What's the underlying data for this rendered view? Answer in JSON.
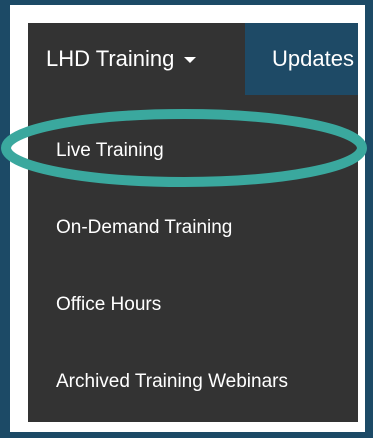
{
  "nav": {
    "menu_label": "LHD Training",
    "next_label": "Updates"
  },
  "dropdown": {
    "items": [
      {
        "label": "Live Training"
      },
      {
        "label": "On-Demand Training"
      },
      {
        "label": "Office Hours"
      },
      {
        "label": "Archived Training Webinars"
      }
    ]
  },
  "colors": {
    "page_background": "#1c4a66",
    "menu_background": "#333333",
    "updates_tab": "#1e4a66",
    "highlight_ring": "#3aa89e"
  }
}
